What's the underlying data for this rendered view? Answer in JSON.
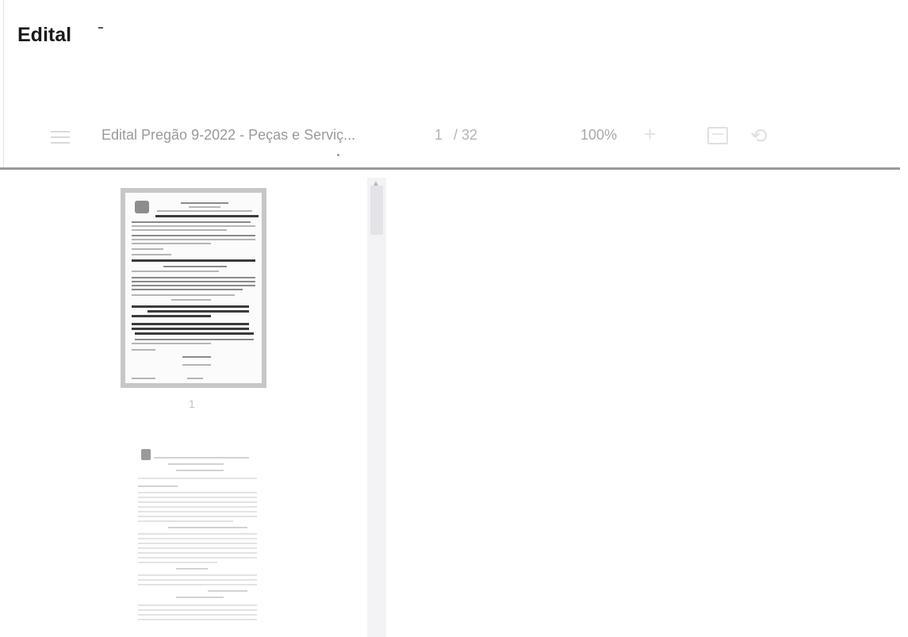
{
  "page": {
    "heading": "Edital"
  },
  "viewer": {
    "toolbar": {
      "menu_icon": "menu-icon",
      "document_title": "Edital Pregão 9-2022 - Peças e Serviç...",
      "current_page": "1",
      "page_total": "/ 32",
      "zoom": "100%",
      "zoom_in_glyph": "+",
      "fit_icon": "fit-page-icon",
      "rotate_icon": "rotate-icon"
    },
    "sidebar": {
      "thumbnails": [
        {
          "label": "1"
        },
        {
          "label": ""
        }
      ]
    },
    "colors": {
      "divider": "#9a9a9a",
      "thumbnail_border": "#c7c7c7",
      "scrollbar_track": "#f3f3f6"
    }
  }
}
